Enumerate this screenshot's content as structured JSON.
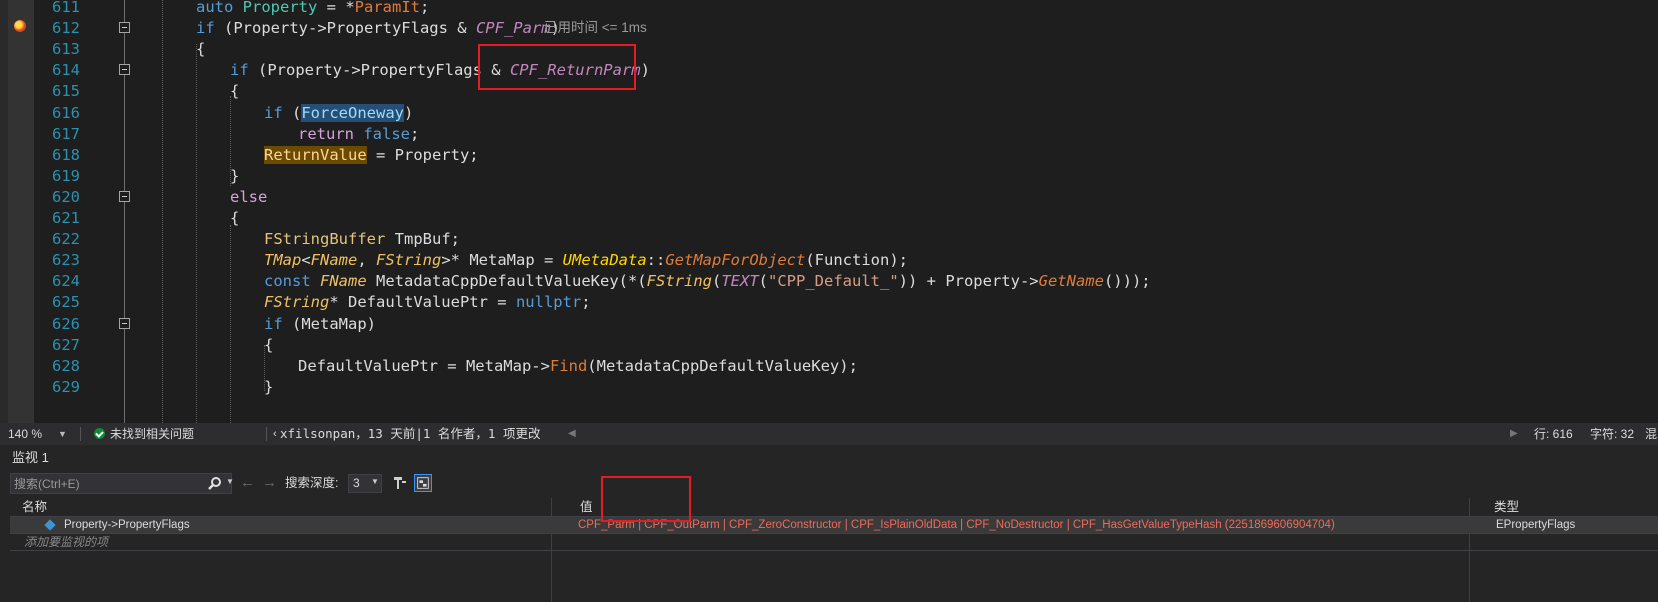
{
  "editor": {
    "lines": [
      {
        "num": "611",
        "fold": false
      },
      {
        "num": "612",
        "fold": true
      },
      {
        "num": "613",
        "fold": false
      },
      {
        "num": "614",
        "fold": true
      },
      {
        "num": "615",
        "fold": false
      },
      {
        "num": "616",
        "fold": false
      },
      {
        "num": "617",
        "fold": false
      },
      {
        "num": "618",
        "fold": false
      },
      {
        "num": "619",
        "fold": false
      },
      {
        "num": "620",
        "fold": true
      },
      {
        "num": "621",
        "fold": false
      },
      {
        "num": "622",
        "fold": false
      },
      {
        "num": "623",
        "fold": false
      },
      {
        "num": "624",
        "fold": false
      },
      {
        "num": "625",
        "fold": false
      },
      {
        "num": "626",
        "fold": true
      },
      {
        "num": "627",
        "fold": false
      },
      {
        "num": "628",
        "fold": false
      },
      {
        "num": "629",
        "fold": false
      }
    ],
    "code": [
      [
        [
          "k",
          "auto"
        ],
        [
          "p",
          " "
        ],
        [
          "t",
          "Property"
        ],
        [
          "p",
          " = *"
        ],
        [
          "f",
          "ParamIt"
        ],
        [
          "p",
          ";"
        ]
      ],
      [
        [
          "k",
          "if"
        ],
        [
          "p",
          " (Property->PropertyFlags & "
        ],
        [
          "m",
          "CPF_Parm"
        ],
        [
          "p",
          ")"
        ]
      ],
      [
        [
          "p",
          "{"
        ]
      ],
      [
        [
          "k",
          "if"
        ],
        [
          "p",
          " (Property->PropertyFlags & "
        ],
        [
          "m",
          "CPF_ReturnParm"
        ],
        [
          "p",
          ")"
        ]
      ],
      [
        [
          "p",
          "{"
        ]
      ],
      [
        [
          "k",
          "if"
        ],
        [
          "p",
          " ("
        ],
        [
          "hl-sel",
          "ForceOneway"
        ],
        [
          "p",
          ")"
        ]
      ],
      [
        [
          "kp",
          "return"
        ],
        [
          "p",
          " "
        ],
        [
          "k",
          "false"
        ],
        [
          "p",
          ";"
        ]
      ],
      [
        [
          "hl-ref",
          "ReturnValue"
        ],
        [
          "p",
          " = Property;"
        ]
      ],
      [
        [
          "p",
          "}"
        ]
      ],
      [
        [
          "kp",
          "else"
        ]
      ],
      [
        [
          "p",
          "{"
        ]
      ],
      [
        [
          "lv",
          "FStringBuffer"
        ],
        [
          "p",
          " TmpBuf;"
        ]
      ],
      [
        [
          "ty",
          "TMap"
        ],
        [
          "p",
          "<"
        ],
        [
          "ty",
          "FName"
        ],
        [
          "p",
          ", "
        ],
        [
          "ty",
          "FString"
        ],
        [
          "p",
          ">* MetaMap = "
        ],
        [
          "cls",
          "UMetaData"
        ],
        [
          "p",
          "::"
        ],
        [
          "fi",
          "GetMapForObject"
        ],
        [
          "p",
          "(Function);"
        ]
      ],
      [
        [
          "k",
          "const"
        ],
        [
          "p",
          " "
        ],
        [
          "ty",
          "FName"
        ],
        [
          "p",
          " MetadataCppDefaultValueKey(*("
        ],
        [
          "ty",
          "FString"
        ],
        [
          "p",
          "("
        ],
        [
          "m",
          "TEXT"
        ],
        [
          "p",
          "("
        ],
        [
          "s",
          "\"CPP_Default_\""
        ],
        [
          "p",
          ")) + Property->"
        ],
        [
          "fi",
          "GetName"
        ],
        [
          "p",
          "()));"
        ]
      ],
      [
        [
          "ty",
          "FString"
        ],
        [
          "p",
          "* DefaultValuePtr = "
        ],
        [
          "k",
          "nullptr"
        ],
        [
          "p",
          ";"
        ]
      ],
      [
        [
          "k",
          "if"
        ],
        [
          "p",
          " (MetaMap)"
        ]
      ],
      [
        [
          "p",
          "{"
        ]
      ],
      [
        [
          "p",
          "DefaultValuePtr = MetaMap->"
        ],
        [
          "f",
          "Find"
        ],
        [
          "p",
          "(MetadataCppDefaultValueKey);"
        ]
      ],
      [
        [
          "p",
          "}"
        ]
      ]
    ],
    "indents": [
      0,
      0,
      0,
      1,
      1,
      2,
      3,
      2,
      1,
      1,
      1,
      2,
      2,
      2,
      2,
      2,
      2,
      3,
      2
    ],
    "annotation": "已用时间 <= 1ms"
  },
  "status_bar": {
    "zoom": "140 %",
    "issues": "未找到相关问题",
    "blame": "xfilsonpan，13 天前|1 名作者，1 项更改",
    "line": "行: 616",
    "char": "字符: 32",
    "col_partial": "混"
  },
  "watch": {
    "title": "监视 1",
    "search_placeholder": "搜索(Ctrl+E)",
    "depth_label": "搜索深度:",
    "depth_value": "3",
    "headers": {
      "name": "名称",
      "value": "值",
      "type": "类型"
    },
    "rows": [
      {
        "name": "Property->PropertyFlags",
        "value": "CPF_Parm | CPF_OutParm | CPF_ZeroConstructor | CPF_IsPlainOldData | CPF_NoDestructor | CPF_HasGetValueTypeHash (2251869606904704)",
        "type": "EPropertyFlags"
      }
    ],
    "add_item": "添加要监视的项"
  },
  "colors": {
    "editor_bg": "#1e1e1e",
    "line_number": "#2b91af",
    "keyword": "#569cd6",
    "macro": "#c586c0",
    "highlight_box": "#e51c23",
    "watch_value": "#f06a5a"
  }
}
